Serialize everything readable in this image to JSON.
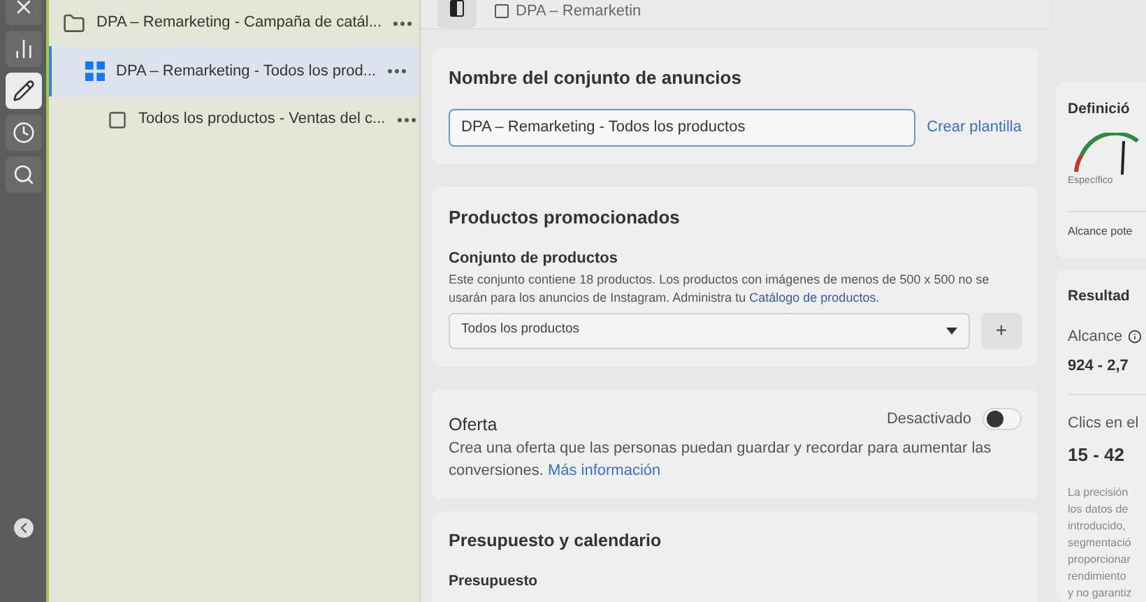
{
  "rail": {
    "items": [
      {
        "kind": "close",
        "selected": false
      },
      {
        "kind": "chart",
        "selected": false
      },
      {
        "kind": "edit",
        "selected": true
      },
      {
        "kind": "history",
        "selected": false
      },
      {
        "kind": "search",
        "selected": false
      }
    ]
  },
  "tree": [
    {
      "kind": "campaign",
      "label": "DPA – Remarketing - Campaña de catál...",
      "selected": false,
      "children": [
        {
          "kind": "adset",
          "label": "DPA – Remarketing - Todos los prod...",
          "selected": true,
          "children": [
            {
              "kind": "ad",
              "label": "Todos los productos - Ventas del c...",
              "selected": false
            }
          ]
        }
      ]
    }
  ],
  "topbar": {
    "title": "DPA – Remarketin"
  },
  "name_card": {
    "title": "Nombre del conjunto de anuncios",
    "value": "DPA – Remarketing - Todos los productos",
    "link": "Crear plantilla"
  },
  "products_card": {
    "title": "Productos promocionados",
    "subtitle": "Conjunto de productos",
    "description": "Este conjunto contiene 18 productos. Los productos con imágenes de menos de 500 x 500 no se usarán para los anuncios de Instagram. Administra tu",
    "link": "Catálogo de productos.",
    "select": "Todos los productos",
    "add": "+"
  },
  "offer_card": {
    "title": "Oferta",
    "toggle_label": "Desactivado",
    "on": false,
    "description": "Crea una oferta que las personas puedan guardar y recordar para aumentar las conversiones.",
    "link": "Más información"
  },
  "budget_card": {
    "title": "Presupuesto y calendario",
    "subtitle": "Presupuesto"
  },
  "definition_card": {
    "title": "Definició",
    "gauge_label": "Específico",
    "reach": "Alcance pote"
  },
  "results_card": {
    "title": "Resultad",
    "reach_label": "Alcance",
    "reach_value": "924 - 2,7",
    "clicks_label": "Clics en el",
    "clicks_value": "15 - 42",
    "note_lines": [
      "La precisión",
      "los datos de",
      "introducido,",
      "segmentació",
      "proporcionar",
      "rendimiento",
      "y no garantiz"
    ]
  }
}
